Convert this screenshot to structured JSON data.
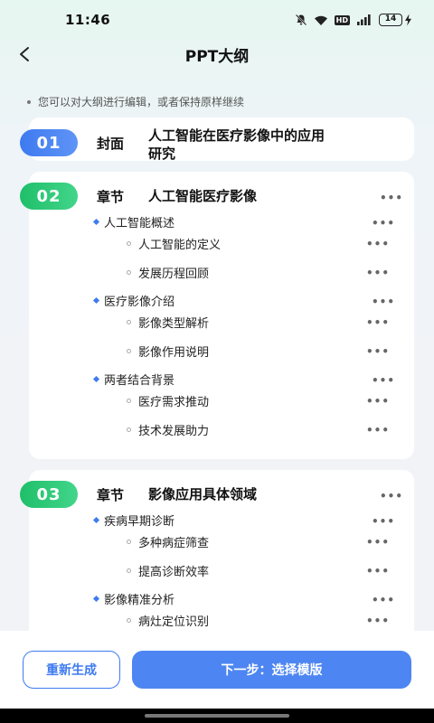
{
  "status_bar": {
    "time": "11:46",
    "battery": "14",
    "icons": [
      "mute-bell-icon",
      "wifi-icon",
      "hd-icon",
      "signal-4g-icon",
      "battery-icon",
      "charging-icon"
    ],
    "hd_label": "HD"
  },
  "header": {
    "title": "PPT大纲",
    "back_icon": "back-arrow-icon"
  },
  "hint": "您可以对大纲进行编辑，或者保持原样继续",
  "sections": [
    {
      "number": "01",
      "type": "封面",
      "title_line1": "人工智能在医疗影像中的应用",
      "title_line2": "研究",
      "color": "#3e7af0"
    },
    {
      "number": "02",
      "type": "章节",
      "title": "人工智能医疗影像",
      "color": "#1fbf6a",
      "subs": [
        {
          "label": "人工智能概述",
          "leaves": [
            "人工智能的定义",
            "发展历程回顾"
          ]
        },
        {
          "label": "医疗影像介绍",
          "leaves": [
            "影像类型解析",
            "影像作用说明"
          ]
        },
        {
          "label": "两者结合背景",
          "leaves": [
            "医疗需求推动",
            "技术发展助力"
          ]
        }
      ]
    },
    {
      "number": "03",
      "type": "章节",
      "title": "影像应用具体领域",
      "color": "#1fbf6a",
      "subs": [
        {
          "label": "疾病早期诊断",
          "leaves": [
            "多种病症筛查",
            "提高诊断效率"
          ]
        },
        {
          "label": "影像精准分析",
          "leaves": [
            "病灶定位识别"
          ]
        }
      ]
    }
  ],
  "more_label": "•••",
  "footer": {
    "regenerate": "重新生成",
    "next": "下一步：选择模版"
  },
  "colors": {
    "accent_blue": "#3e7af0",
    "accent_green": "#1fbf6a"
  }
}
